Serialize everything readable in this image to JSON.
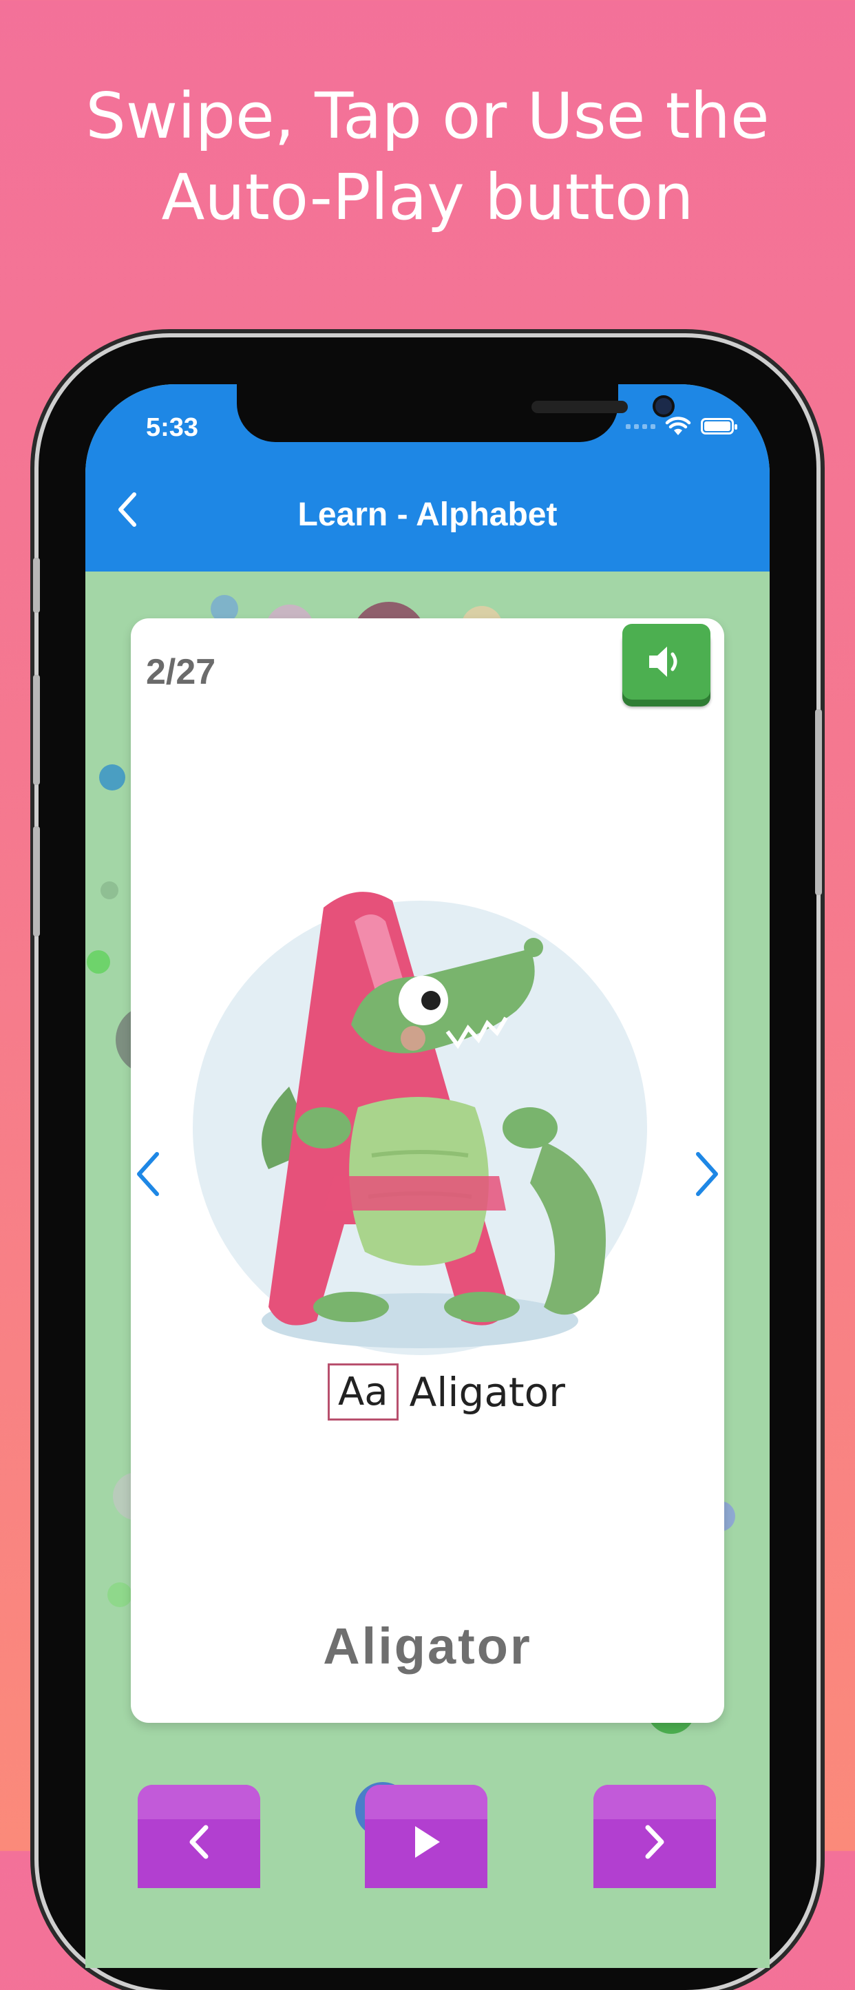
{
  "headline": {
    "line1": "Swipe, Tap or Use the",
    "line2": "Auto-Play button"
  },
  "status_bar": {
    "time": "5:33"
  },
  "app_bar": {
    "title": "Learn - Alphabet",
    "back_icon": "chevron-left-icon"
  },
  "card": {
    "counter": "2/27",
    "sound_icon": "speaker-icon",
    "prev_icon": "chevron-left-icon",
    "next_icon": "chevron-right-icon",
    "illustration": "letter-a-alligator-illustration",
    "caption_letters": "Aa",
    "caption_word": "Aligator",
    "word": "Aligator"
  },
  "controls": {
    "previous_icon": "chevron-left-icon",
    "play_icon": "play-icon",
    "next_icon": "chevron-right-icon"
  },
  "colors": {
    "background_top": "#f37199",
    "background_bottom": "#fb8a7a",
    "app_bar": "#1e87e5",
    "screen_bg": "#a3d6a6",
    "sound_button": "#4caf50",
    "control_buttons": "#b23fd0",
    "arrow_blue": "#1e87e5"
  }
}
